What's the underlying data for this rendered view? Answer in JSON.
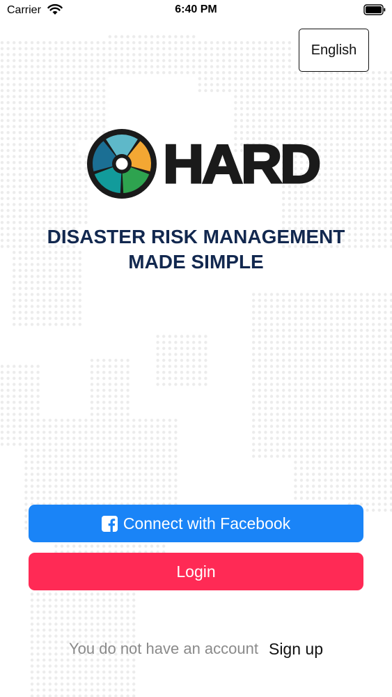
{
  "status_bar": {
    "carrier": "Carrier",
    "time": "6:40 PM",
    "wifi_icon": "wifi-icon",
    "battery_icon": "battery-icon"
  },
  "language_button": {
    "label": "English"
  },
  "logo": {
    "wordmark": "HARD",
    "wheel_colors": [
      "#1b6f94",
      "#5eb8c9",
      "#f3a733",
      "#2ea34f",
      "#129b9b"
    ]
  },
  "tagline": {
    "line1": "DISASTER RISK MANAGEMENT",
    "line2": "MADE SIMPLE"
  },
  "facebook_button": {
    "label": "Connect with Facebook",
    "icon": "facebook-icon"
  },
  "login_button": {
    "label": "Login"
  },
  "signup": {
    "prompt": "You do not have an account",
    "link": "Sign up"
  },
  "colors": {
    "facebook": "#1a84f7",
    "login": "#ff2a55",
    "tagline": "#12284f"
  }
}
